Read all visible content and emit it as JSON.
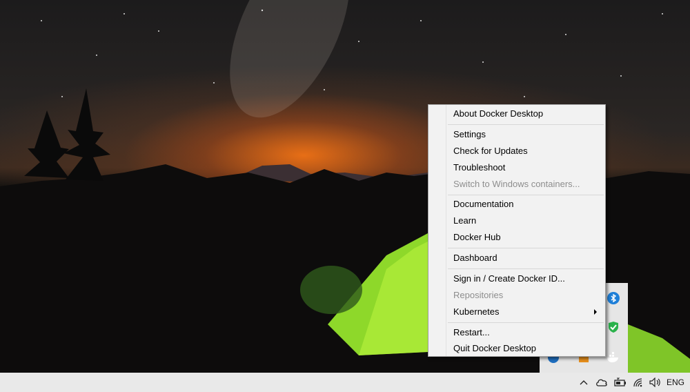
{
  "context_menu": {
    "items": [
      {
        "label": "About Docker Desktop",
        "enabled": true
      },
      {
        "label": "Settings",
        "enabled": true
      },
      {
        "label": "Check for Updates",
        "enabled": true
      },
      {
        "label": "Troubleshoot",
        "enabled": true
      },
      {
        "label": "Switch to Windows containers...",
        "enabled": false
      },
      {
        "label": "Documentation",
        "enabled": true
      },
      {
        "label": "Learn",
        "enabled": true
      },
      {
        "label": "Docker Hub",
        "enabled": true
      },
      {
        "label": "Dashboard",
        "enabled": true
      },
      {
        "label": "Sign in / Create Docker ID...",
        "enabled": true
      },
      {
        "label": "Repositories",
        "enabled": false
      },
      {
        "label": "Kubernetes",
        "enabled": true,
        "has_submenu": true
      },
      {
        "label": "Restart...",
        "enabled": true
      },
      {
        "label": "Quit Docker Desktop",
        "enabled": true
      }
    ]
  },
  "tray_overflow_icons": [
    "bluetooth-icon",
    "security-check-icon",
    "app-blue-icon",
    "app-orange-icon",
    "docker-whale-icon"
  ],
  "taskbar": {
    "icons": [
      "chevron-up-icon",
      "onedrive-cloud-icon",
      "battery-icon",
      "wifi-icon",
      "volume-icon"
    ],
    "language": "ENG"
  },
  "colors": {
    "menu_background": "#f2f2f2",
    "disabled_text": "#8d8d8d",
    "taskbar": "#e9e9e9",
    "security_green": "#2bb24c",
    "bluetooth_blue": "#1e7fd8"
  }
}
